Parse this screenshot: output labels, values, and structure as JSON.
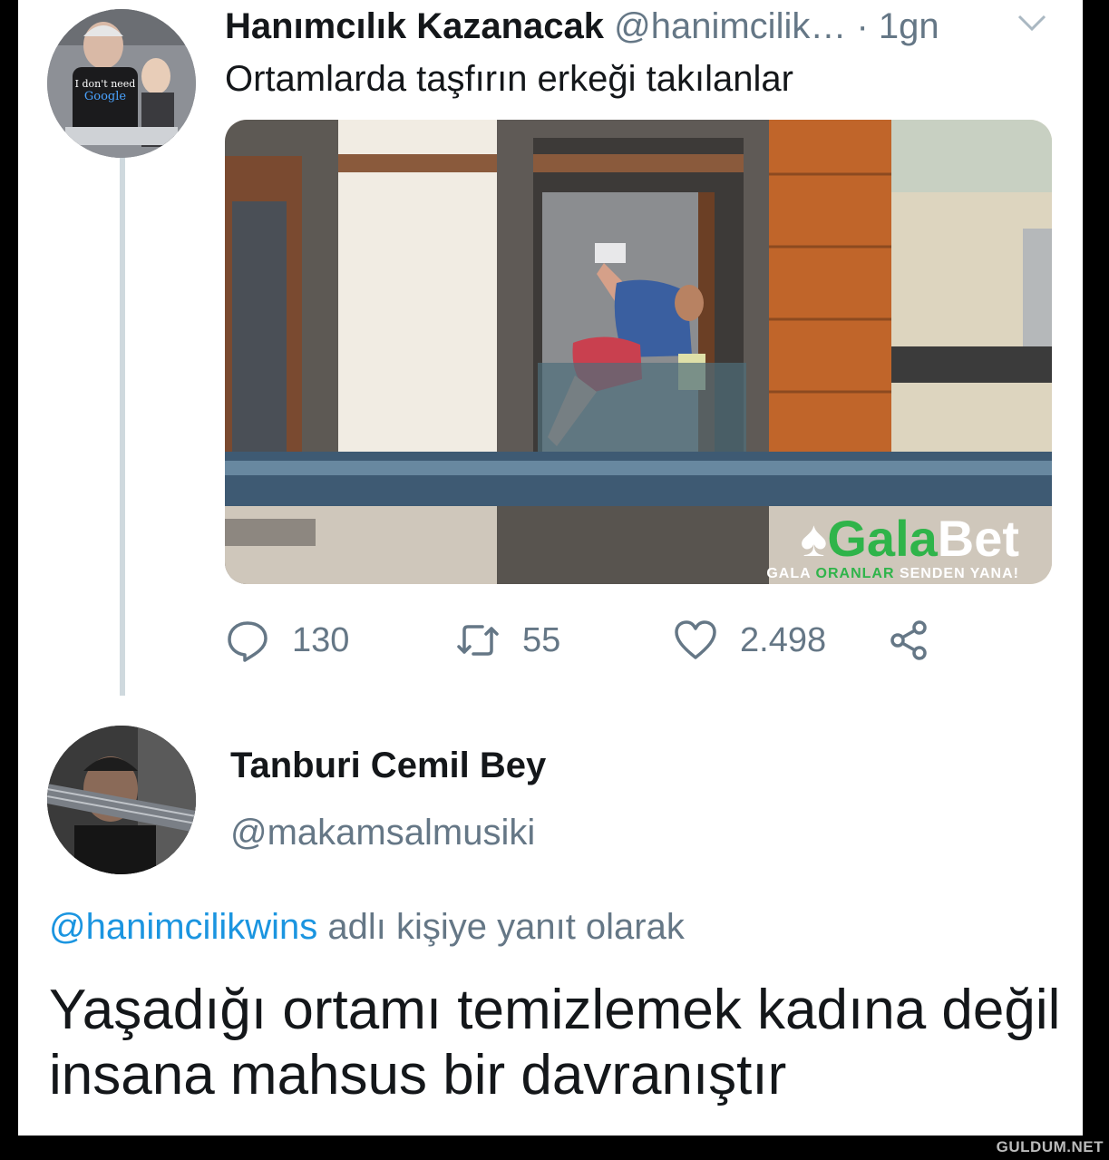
{
  "tweet1": {
    "display_name": "Hanımcılık Kazanacak",
    "handle": "@hanimcilik…",
    "separator": " · ",
    "time": "1gn",
    "text": "Ortamlarda taşfırın erkeği takılanlar",
    "media": {
      "watermark_brand_part1": "Gala",
      "watermark_brand_part2": "Bet",
      "watermark_tag_part1": "GALA ",
      "watermark_tag_highlight": "ORANLAR",
      "watermark_tag_part2": " SENDEN YANA!"
    },
    "actions": {
      "reply_count": "130",
      "retweet_count": "55",
      "like_count": "2.498"
    }
  },
  "tweet2": {
    "display_name": "Tanburi Cemil Bey",
    "handle": "@makamsalmusiki",
    "reply_to_handle": "@hanimcilikwins",
    "reply_to_suffix": " adlı kişiye yanıt olarak",
    "text": "Yaşadığı ortamı temizlemek kadına değil insana mahsus bir davranıştır"
  },
  "site_watermark": "GULDUM.NET",
  "colors": {
    "link_blue": "#1b95e0",
    "muted_gray": "#657786",
    "text_dark": "#14171a",
    "brand_green": "#2fb44a"
  }
}
